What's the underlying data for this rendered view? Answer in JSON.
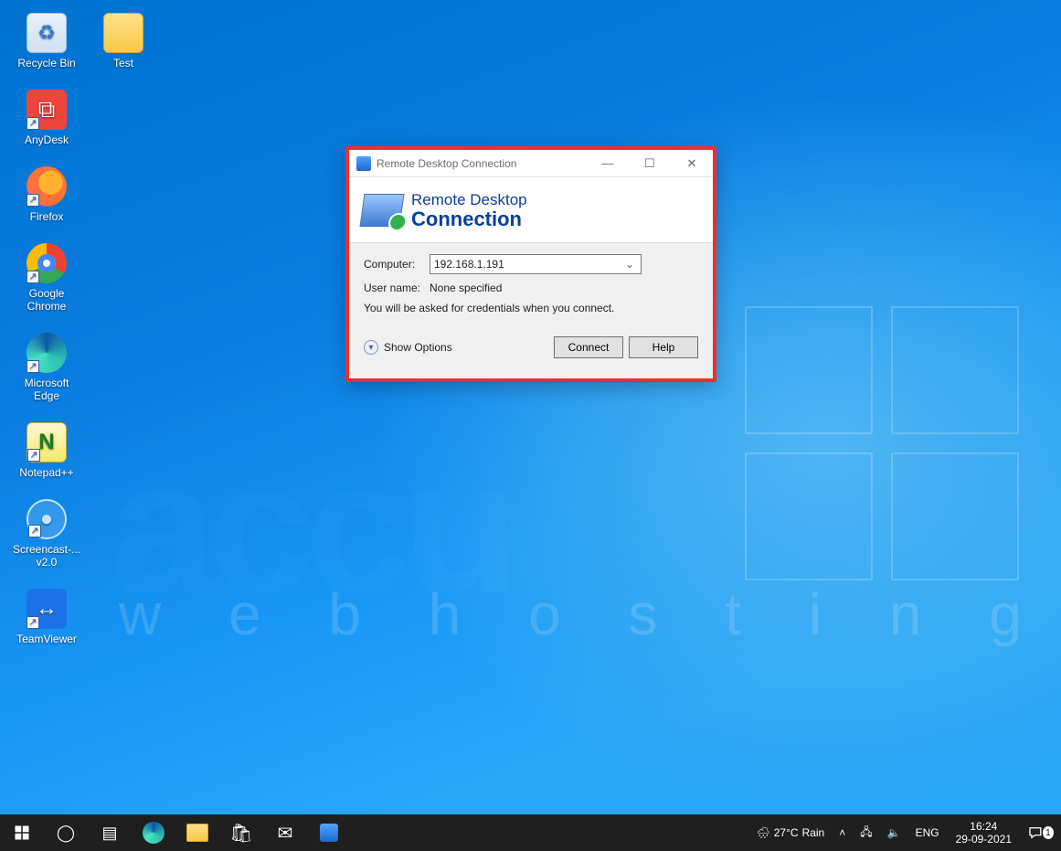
{
  "desktop_icons": [
    {
      "name": "Recycle Bin",
      "kind": "recycle",
      "shortcut": false
    },
    {
      "name": "AnyDesk",
      "kind": "anydesk",
      "shortcut": true
    },
    {
      "name": "Firefox",
      "kind": "firefox",
      "shortcut": true
    },
    {
      "name": "Google Chrome",
      "kind": "chrome",
      "shortcut": true
    },
    {
      "name": "Microsoft Edge",
      "kind": "edge",
      "shortcut": true
    },
    {
      "name": "Notepad++",
      "kind": "npp",
      "shortcut": true
    },
    {
      "name": "Screencast-... v2.0",
      "kind": "scm",
      "shortcut": true
    },
    {
      "name": "TeamViewer",
      "kind": "tv",
      "shortcut": true
    }
  ],
  "desktop_icon_test": {
    "name": "Test",
    "kind": "folder",
    "shortcut": false
  },
  "watermark": {
    "brand": "accu",
    "tagline": "w e b   h o s t i n g"
  },
  "rdc": {
    "title": "Remote Desktop Connection",
    "heading_line1": "Remote Desktop",
    "heading_line2": "Connection",
    "computer_label": "Computer:",
    "computer_value": "192.168.1.191",
    "username_label": "User name:",
    "username_value": "None specified",
    "hint": "You will be asked for credentials when you connect.",
    "show_options": "Show Options",
    "btn_connect": "Connect",
    "btn_help": "Help"
  },
  "taskbar": {
    "weather_temp": "27°C",
    "weather_text": "Rain",
    "lang": "ENG",
    "time": "16:24",
    "date": "29-09-2021",
    "notif_count": "1"
  }
}
